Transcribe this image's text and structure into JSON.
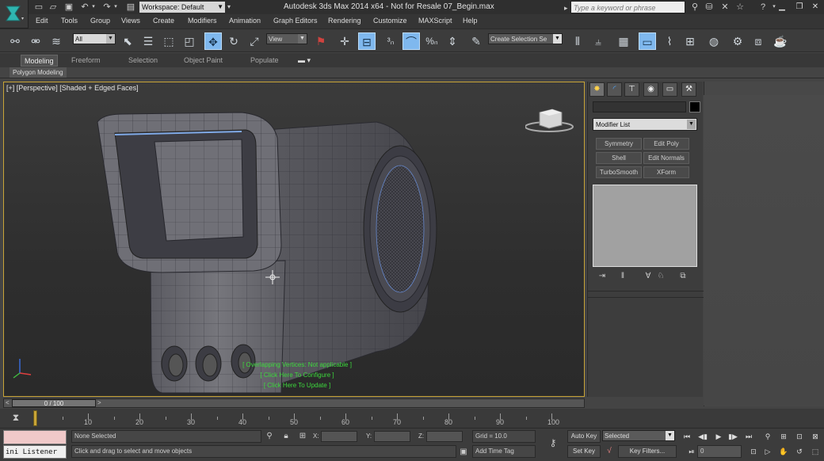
{
  "window": {
    "title": "Autodesk 3ds Max  2014 x64   - Not for Resale   07_Begin.max",
    "workspace": "Workspace: Default",
    "search_placeholder": "Type a keyword or phrase"
  },
  "menu": [
    "Edit",
    "Tools",
    "Group",
    "Views",
    "Create",
    "Modifiers",
    "Animation",
    "Graph Editors",
    "Rendering",
    "Customize",
    "MAXScript",
    "Help"
  ],
  "toolbar": {
    "selection_filter": "All",
    "ref_coord": "View",
    "named_selection": "Create Selection Se",
    "snap_labels": {
      "snap3": "3",
      "angle": "%"
    }
  },
  "ribbon": {
    "tabs": [
      "Modeling",
      "Freeform",
      "Selection",
      "Object Paint",
      "Populate"
    ],
    "active_tab": "Modeling",
    "sub_label": "Polygon Modeling"
  },
  "viewport": {
    "label": "[+] [Perspective] [Shaded + Edged Faces]",
    "messages": [
      "[ Overlapping Vertices: Not applicable ]",
      "[ Click Here To Configure ]",
      "[ Click Here To Update ]"
    ]
  },
  "command_panel": {
    "modifier_list": "Modifier List",
    "modifier_buttons": [
      "Symmetry",
      "Edit Poly",
      "Shell",
      "Edit Normals",
      "TurboSmooth",
      "XForm"
    ]
  },
  "time_slider": {
    "frame_display": "0 / 100",
    "ticks": [
      "10",
      "20",
      "30",
      "40",
      "50",
      "60",
      "70",
      "80",
      "90",
      "100"
    ]
  },
  "status": {
    "listener": "ini Listener",
    "selection_status": "None Selected",
    "prompt": "Click and drag to select and move objects",
    "coord_x": "X:",
    "coord_y": "Y:",
    "coord_z": "Z:",
    "grid": "Grid = 10.0",
    "add_time_tag": "Add Time Tag",
    "auto_key": "Auto Key",
    "set_key": "Set Key",
    "selected": "Selected",
    "key_filters": "Key Filters...",
    "current_frame": "0"
  }
}
